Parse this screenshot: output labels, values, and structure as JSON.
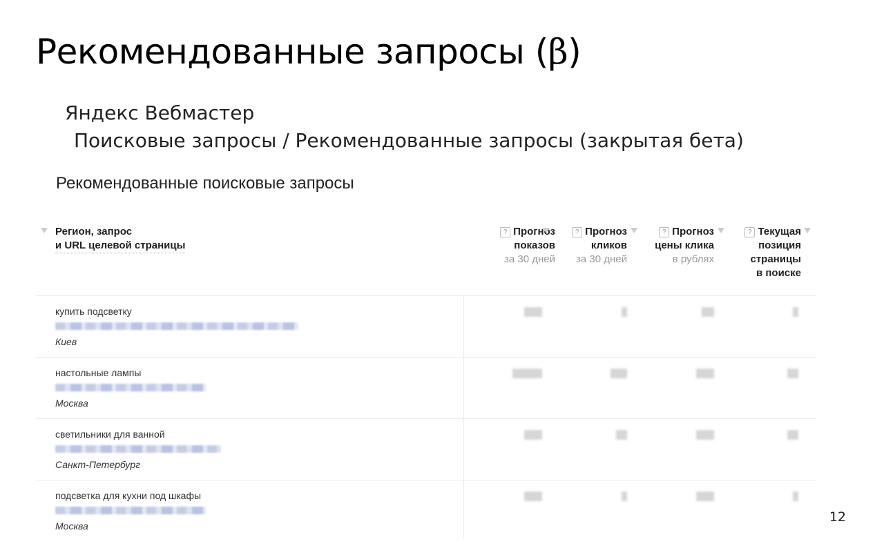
{
  "slide": {
    "title": "Рекомендованные запросы (",
    "title_beta": "β",
    "title_close": ")",
    "subtitle_line1": "Яндекс Вебмастер",
    "subtitle_line2": "Поисковые запросы / Рекомендованные запросы (закрытая бета)",
    "page_number": "12"
  },
  "screenshot": {
    "heading": "Рекомендованные поисковые запросы",
    "columns": {
      "region_query_l1": "Регион, запрос",
      "region_query_l2": "и URL целевой страницы",
      "impressions_l1": "Прогноз",
      "impressions_l2": "показов",
      "impressions_sub": "за 30 дней",
      "clicks_l1": "Прогноз",
      "clicks_l2": "кликов",
      "clicks_sub": "за 30 дней",
      "price_l1": "Прогноз",
      "price_l2": "цены клика",
      "price_sub": "в рублях",
      "position_l1": "Текущая",
      "position_l2": "позиция",
      "position_l3": "страницы",
      "position_l4": "в поиске"
    },
    "help_glyph": "?",
    "rows": [
      {
        "query": "купить подсветку",
        "region": "Киев"
      },
      {
        "query": "настольные лампы",
        "region": "Москва"
      },
      {
        "query": "светильники для ванной",
        "region": "Санкт-Петербург"
      },
      {
        "query": "подсветка для кухни под шкафы",
        "region": "Москва"
      }
    ]
  }
}
